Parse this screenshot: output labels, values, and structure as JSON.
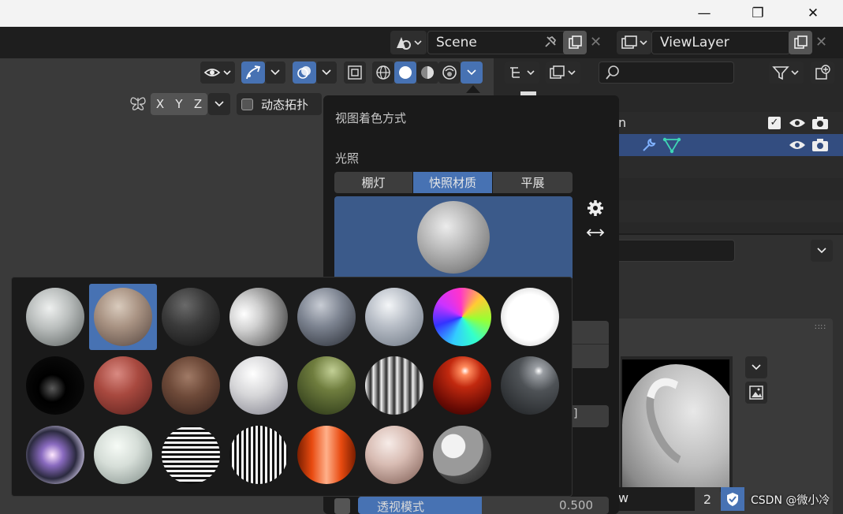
{
  "window": {
    "minimize_glyph": "—",
    "maximize_glyph": "❐",
    "close_glyph": "✕"
  },
  "topbar": {
    "scene_value": "Scene",
    "view_layer_value": "ViewLayer"
  },
  "viewport_header": {
    "axis_x": "X",
    "axis_y": "Y",
    "axis_z": "Z",
    "dynamic_topology_label": "动态拓扑"
  },
  "outliner": {
    "row1_partial_text": "n"
  },
  "properties": {
    "bottom_partial_text": "w",
    "count_value": "2"
  },
  "shading_popover": {
    "title": "视图着色方式",
    "lighting_label": "光照",
    "lighting_options": [
      "棚灯",
      "快照材质",
      "平展"
    ],
    "selected_lighting": "快照材质",
    "xray_label": "透视模式",
    "xray_value": "0.500"
  },
  "watermark": "CSDN @微小冷",
  "colors": {
    "accent_blue": "#4772b3",
    "preview_blue": "#3b5a8a",
    "popover_bg": "#1a1a1a"
  },
  "matcaps": [
    {
      "name": "basic-1",
      "icon": "matcap-basic-grey"
    },
    {
      "name": "basic-2",
      "icon": "matcap-skin",
      "selected": true
    },
    {
      "name": "basic-dark",
      "icon": "matcap-dark"
    },
    {
      "name": "basic-side",
      "icon": "matcap-side-light"
    },
    {
      "name": "ceramic-dark",
      "icon": "matcap-ceramic-dark"
    },
    {
      "name": "ceramic-light",
      "icon": "matcap-ceramic-light"
    },
    {
      "name": "check-normal-y",
      "icon": "matcap-normal-rainbow"
    },
    {
      "name": "check-rim-light",
      "icon": "matcap-white"
    },
    {
      "name": "check-rim-dark",
      "icon": "matcap-rim-dark"
    },
    {
      "name": "clay-brown",
      "icon": "matcap-clay-red"
    },
    {
      "name": "clay-muddy",
      "icon": "matcap-clay-brown"
    },
    {
      "name": "clay-studio",
      "icon": "matcap-clay-studio"
    },
    {
      "name": "jade",
      "icon": "matcap-green"
    },
    {
      "name": "metal-anisotropic",
      "icon": "matcap-metal-stripes"
    },
    {
      "name": "metal-carpaint",
      "icon": "matcap-red-gloss"
    },
    {
      "name": "metal-lead",
      "icon": "matcap-dark-gloss"
    },
    {
      "name": "metal-shiny",
      "icon": "matcap-chrome"
    },
    {
      "name": "pearl",
      "icon": "matcap-pearl"
    },
    {
      "name": "reflection-check-horizontal",
      "icon": "matcap-stripes-horizontal"
    },
    {
      "name": "reflection-check-vertical",
      "icon": "matcap-stripes-vertical"
    },
    {
      "name": "resin",
      "icon": "matcap-orange"
    },
    {
      "name": "skin",
      "icon": "matcap-skin-pink"
    },
    {
      "name": "toon",
      "icon": "matcap-toon"
    }
  ]
}
